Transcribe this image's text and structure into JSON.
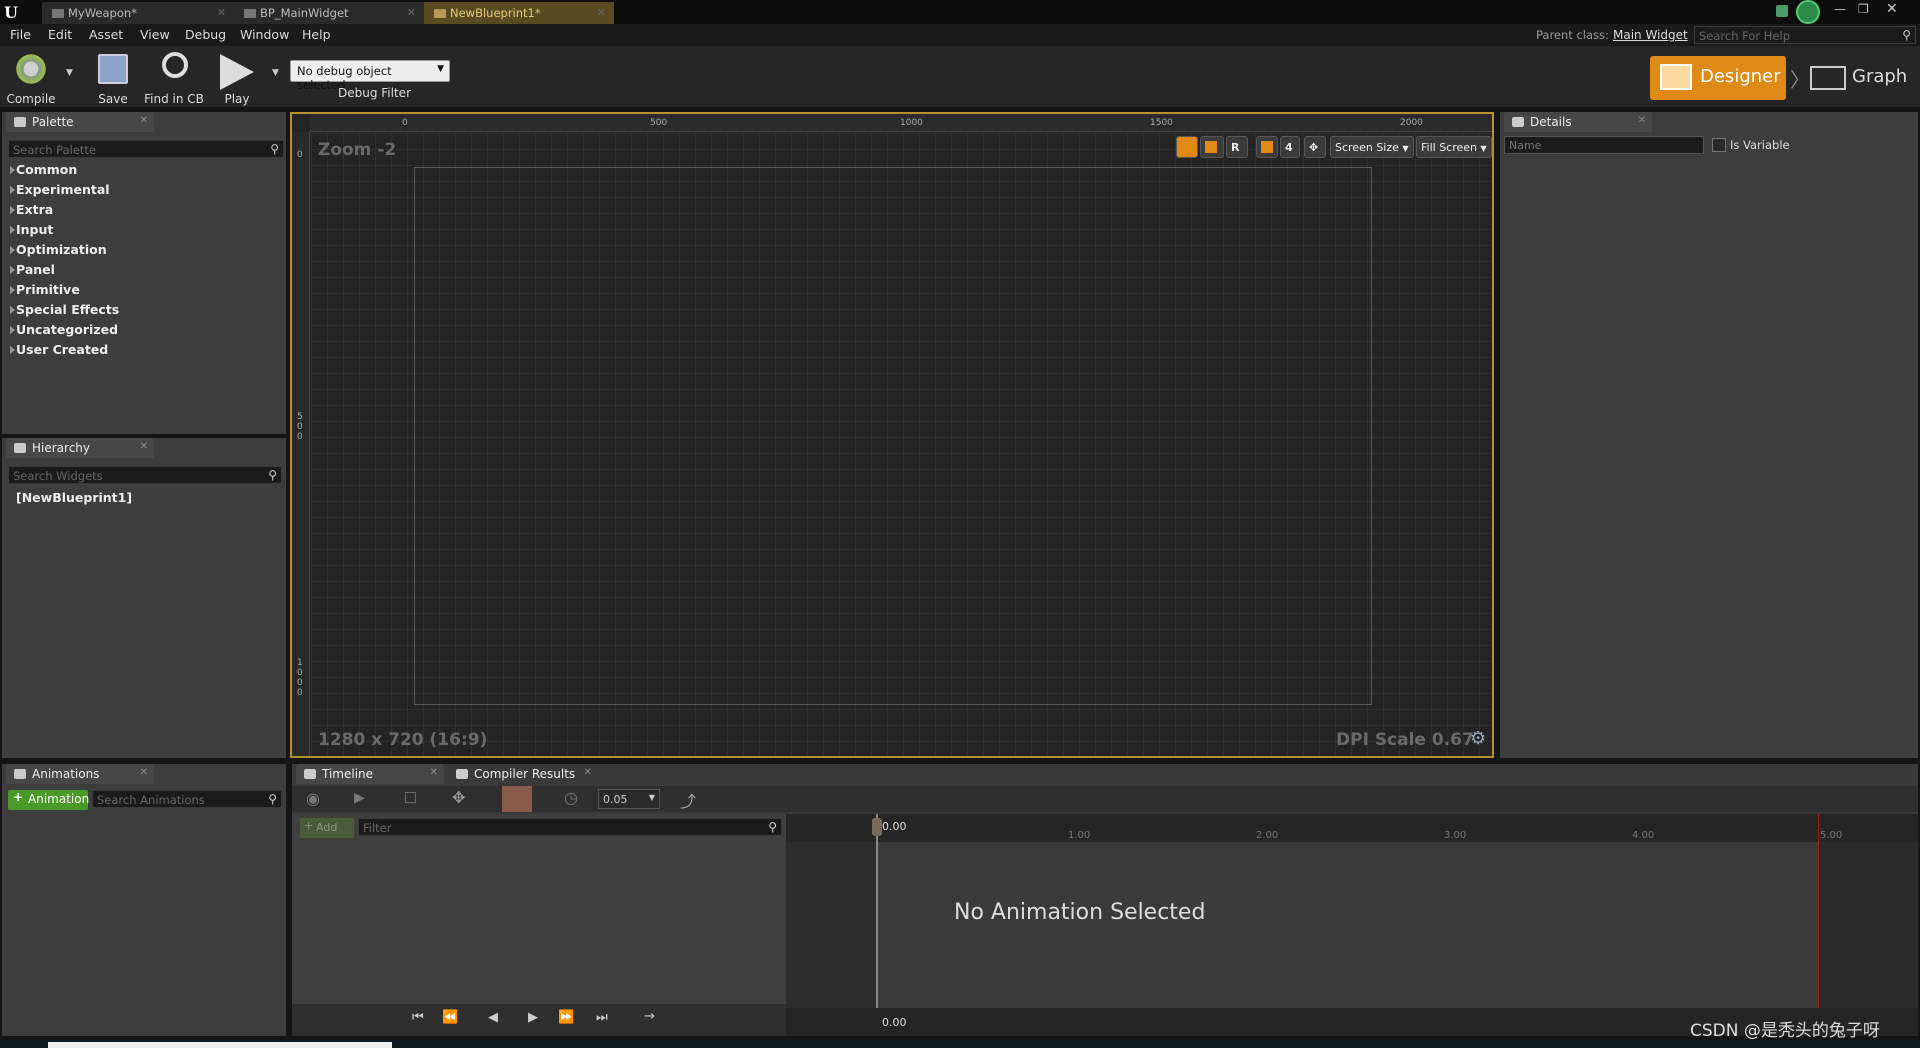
{
  "tabs": [
    {
      "label": "MyWeapon*",
      "active": false
    },
    {
      "label": "BP_MainWidget",
      "active": false
    },
    {
      "label": "NewBlueprint1*",
      "active": true
    }
  ],
  "menu": [
    "File",
    "Edit",
    "Asset",
    "View",
    "Debug",
    "Window",
    "Help"
  ],
  "parent_class": {
    "label": "Parent class:",
    "value": "Main Widget"
  },
  "help_search": {
    "placeholder": "Search For Help"
  },
  "toolbar": {
    "compile": "Compile",
    "save": "Save",
    "find_in_cb": "Find in CB",
    "play": "Play",
    "debug_object": "No debug object selected",
    "debug_filter": "Debug Filter"
  },
  "modes": {
    "designer": "Designer",
    "graph": "Graph"
  },
  "palette": {
    "title": "Palette",
    "search_placeholder": "Search Palette",
    "categories": [
      "Common",
      "Experimental",
      "Extra",
      "Input",
      "Optimization",
      "Panel",
      "Primitive",
      "Special Effects",
      "Uncategorized",
      "User Created"
    ]
  },
  "hierarchy": {
    "title": "Hierarchy",
    "search_placeholder": "Search Widgets",
    "root": "[NewBlueprint1]"
  },
  "animations": {
    "title": "Animations",
    "add_button": "Animation",
    "search_placeholder": "Search Animations"
  },
  "details": {
    "title": "Details",
    "name_placeholder": "Name",
    "is_variable": "Is Variable"
  },
  "designer": {
    "zoom": "Zoom -2",
    "resolution": "1280 x 720 (16:9)",
    "dpi": "DPI Scale 0.67",
    "ruler_h": [
      "0",
      "500",
      "1000",
      "1500",
      "2000"
    ],
    "ruler_v": [
      "0",
      "5\n0\n0",
      "1\n0\n0\n0"
    ],
    "grid_snap": "4",
    "r_button": "R",
    "screen_size": "Screen Size",
    "fill_screen": "Fill Screen"
  },
  "timeline": {
    "tab_timeline": "Timeline",
    "tab_compiler": "Compiler Results",
    "step": "0.05",
    "add": "Add",
    "filter_placeholder": "Filter",
    "no_animation": "No Animation Selected",
    "current_time": "0.00",
    "ticks": [
      "0.00",
      "1.00",
      "2.00",
      "3.00",
      "4.00",
      "5.00"
    ]
  },
  "watermark": "CSDN @是秃头的兔子呀"
}
